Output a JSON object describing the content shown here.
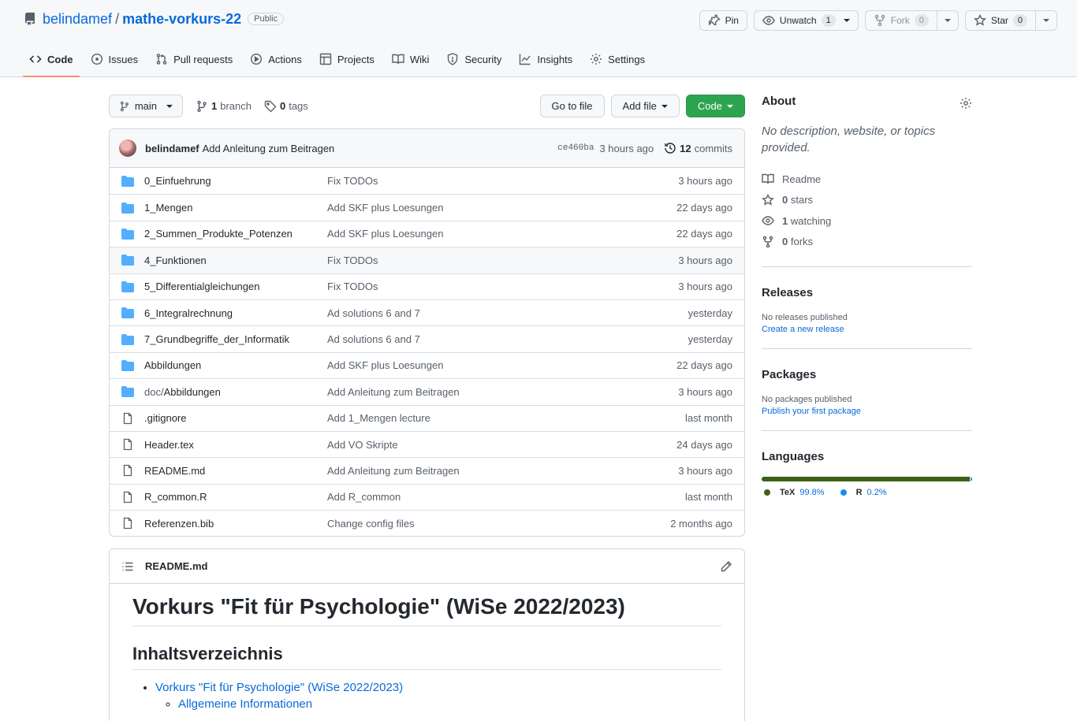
{
  "repo": {
    "owner": "belindamef",
    "separator": "/",
    "name": "mathe-vorkurs-22",
    "visibility": "Public"
  },
  "header_actions": {
    "pin": "Pin",
    "unwatch": "Unwatch",
    "watch_count": "1",
    "fork": "Fork",
    "fork_count": "0",
    "star": "Star",
    "star_count": "0"
  },
  "tabs": [
    {
      "label": "Code",
      "icon": "code-icon",
      "active": true
    },
    {
      "label": "Issues",
      "icon": "issue-icon"
    },
    {
      "label": "Pull requests",
      "icon": "pull-request-icon"
    },
    {
      "label": "Actions",
      "icon": "play-icon"
    },
    {
      "label": "Projects",
      "icon": "table-icon"
    },
    {
      "label": "Wiki",
      "icon": "book-icon"
    },
    {
      "label": "Security",
      "icon": "shield-icon"
    },
    {
      "label": "Insights",
      "icon": "graph-icon"
    },
    {
      "label": "Settings",
      "icon": "gear-icon"
    }
  ],
  "toolbar": {
    "branch": "main",
    "branch_count": "1",
    "branch_label": "branch",
    "tag_count": "0",
    "tag_label": "tags",
    "go_to_file": "Go to file",
    "add_file": "Add file",
    "code": "Code"
  },
  "latest_commit": {
    "author": "belindamef",
    "message": "Add Anleitung zum Beitragen",
    "sha": "ce460ba",
    "time": "3 hours ago",
    "commit_count": "12",
    "commit_label": "commits"
  },
  "files": [
    {
      "type": "dir",
      "name": "0_Einfuehrung",
      "message": "Fix TODOs",
      "age": "3 hours ago"
    },
    {
      "type": "dir",
      "name": "1_Mengen",
      "message": "Add SKF plus Loesungen",
      "age": "22 days ago"
    },
    {
      "type": "dir",
      "name": "2_Summen_Produkte_Potenzen",
      "message": "Add SKF plus Loesungen",
      "age": "22 days ago"
    },
    {
      "type": "dir",
      "name": "4_Funktionen",
      "message": "Fix TODOs",
      "age": "3 hours ago"
    },
    {
      "type": "dir",
      "name": "5_Differentialgleichungen",
      "message": "Fix TODOs",
      "age": "3 hours ago"
    },
    {
      "type": "dir",
      "name": "6_Integralrechnung",
      "message": "Ad solutions 6 and 7",
      "age": "yesterday"
    },
    {
      "type": "dir",
      "name": "7_Grundbegriffe_der_Informatik",
      "message": "Ad solutions 6 and 7",
      "age": "yesterday"
    },
    {
      "type": "dir",
      "name": "Abbildungen",
      "message": "Add SKF plus Loesungen",
      "age": "22 days ago"
    },
    {
      "type": "dir",
      "prefix": "doc/",
      "name": "Abbildungen",
      "message": "Add Anleitung zum Beitragen",
      "age": "3 hours ago"
    },
    {
      "type": "file",
      "name": ".gitignore",
      "message": "Add 1_Mengen lecture",
      "age": "last month"
    },
    {
      "type": "file",
      "name": "Header.tex",
      "message": "Add VO Skripte",
      "age": "24 days ago"
    },
    {
      "type": "file",
      "name": "README.md",
      "message": "Add Anleitung zum Beitragen",
      "age": "3 hours ago"
    },
    {
      "type": "file",
      "name": "R_common.R",
      "message": "Add R_common",
      "age": "last month"
    },
    {
      "type": "file",
      "name": "Referenzen.bib",
      "message": "Change config files",
      "age": "2 months ago"
    }
  ],
  "readme": {
    "filename": "README.md",
    "h1": "Vorkurs \"Fit für Psychologie\" (WiSe 2022/2023)",
    "h2": "Inhaltsverzeichnis",
    "toc_item": "Vorkurs \"Fit für Psychologie\" (WiSe 2022/2023)",
    "toc_subitem": "Allgemeine Informationen"
  },
  "sidebar": {
    "about_title": "About",
    "about_desc": "No description, website, or topics provided.",
    "items": [
      {
        "icon": "book-icon",
        "label": "Readme"
      },
      {
        "icon": "star-icon",
        "count": "0",
        "label": "stars"
      },
      {
        "icon": "eye-icon",
        "count": "1",
        "label": "watching"
      },
      {
        "icon": "fork-icon",
        "count": "0",
        "label": "forks"
      }
    ],
    "releases_title": "Releases",
    "releases_none": "No releases published",
    "releases_link": "Create a new release",
    "packages_title": "Packages",
    "packages_none": "No packages published",
    "packages_link": "Publish your first package",
    "languages_title": "Languages",
    "languages": [
      {
        "name": "TeX",
        "percent": "99.8%",
        "color": "#3D6117"
      },
      {
        "name": "R",
        "percent": "0.2%",
        "color": "#198CE7"
      }
    ]
  }
}
